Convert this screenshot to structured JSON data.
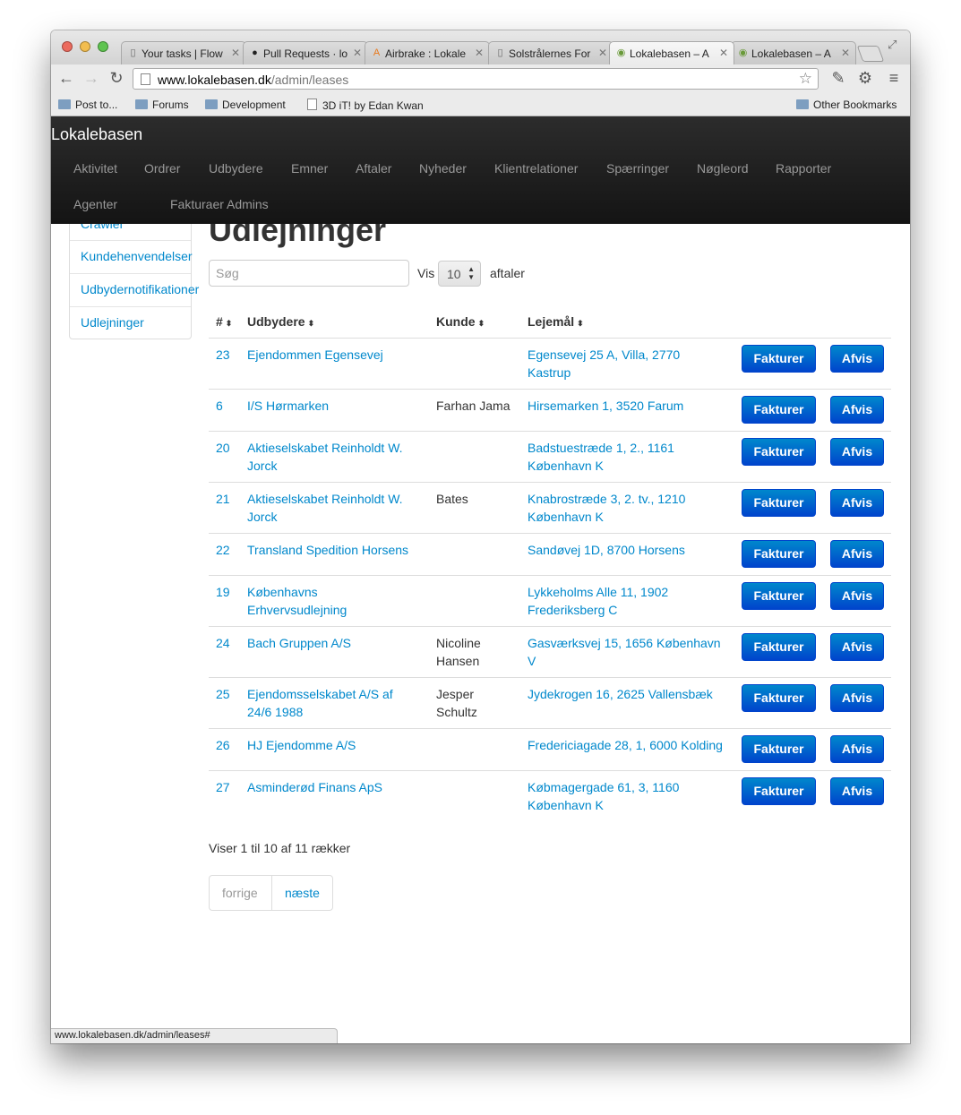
{
  "browser": {
    "tabs": [
      {
        "title": "Your tasks | Flow",
        "icon": "page-icon"
      },
      {
        "title": "Pull Requests · lo",
        "icon": "github-icon"
      },
      {
        "title": "Airbrake : Lokale",
        "icon": "airbrake-icon"
      },
      {
        "title": "Solstrålernes For",
        "icon": "page-icon"
      },
      {
        "title": "Lokalebasen – A",
        "icon": "map-pin-icon"
      },
      {
        "title": "Lokalebasen – A",
        "icon": "map-pin-icon"
      }
    ],
    "url_host": "www.lokalebasen.dk",
    "url_path": "/admin/leases",
    "bookmarks": [
      "Post to...",
      "Forums",
      "Development",
      "3D iT! by Edan Kwan"
    ],
    "other_bookmarks": "Other Bookmarks",
    "status_url": "www.lokalebasen.dk/admin/leases#"
  },
  "site": {
    "brand": "Lokalebasen",
    "nav": [
      "Aktivitet",
      "Ordrer",
      "Udbydere",
      "Emner",
      "Aftaler",
      "Nyheder",
      "Klientrelationer",
      "Spærringer",
      "Nøgleord",
      "Rapporter",
      "Agenter",
      "Fakturaer",
      "Admins"
    ]
  },
  "sidebar": {
    "items": [
      "Crawler",
      "Kundehenvendelser",
      "Udbydernotifikationer",
      "Udlejninger"
    ]
  },
  "main": {
    "title": "Udlejninger",
    "search_placeholder": "Søg",
    "show_label": "Vis",
    "page_size": "10",
    "after_label": "aftaler",
    "columns": [
      "#",
      "Udbydere",
      "Kunde",
      "Lejemål"
    ],
    "invoice_label": "Fakturer",
    "reject_label": "Afvis",
    "rows": [
      {
        "id": "23",
        "provider": [
          "Ejendommen Egensevej"
        ],
        "customer": [],
        "lease": [
          "Egensevej 25 A, Villa, 2770",
          "Kastrup"
        ]
      },
      {
        "id": "6",
        "provider": [
          "I/S Hørmarken"
        ],
        "customer": [
          "Farhan Jama"
        ],
        "lease": [
          "Hirsemarken 1, 3520 Farum"
        ]
      },
      {
        "id": "20",
        "provider": [
          "Aktieselskabet Reinholdt W.",
          "Jorck"
        ],
        "customer": [],
        "lease": [
          "Badstuestræde 1, 2., 1161",
          "København K"
        ]
      },
      {
        "id": "21",
        "provider": [
          "Aktieselskabet Reinholdt W.",
          "Jorck"
        ],
        "customer": [
          "Bates"
        ],
        "lease": [
          "Knabrostræde 3, 2. tv., 1210",
          "København K"
        ]
      },
      {
        "id": "22",
        "provider": [
          "Transland Spedition Horsens"
        ],
        "customer": [],
        "lease": [
          "Sandøvej 1D, 8700 Horsens"
        ]
      },
      {
        "id": "19",
        "provider": [
          "Københavns",
          "Erhvervsudlejning"
        ],
        "customer": [],
        "lease": [
          "Lykkeholms Alle 11, 1902",
          "Frederiksberg C"
        ]
      },
      {
        "id": "24",
        "provider": [
          "Bach Gruppen A/S"
        ],
        "customer": [
          "Nicoline",
          "Hansen"
        ],
        "lease": [
          "Gasværksvej 15, 1656 København",
          "V"
        ]
      },
      {
        "id": "25",
        "provider": [
          "Ejendomsselskabet A/S af",
          "24/6 1988"
        ],
        "customer": [
          "Jesper",
          "Schultz"
        ],
        "lease": [
          "Jydekrogen 16, 2625 Vallensbæk"
        ]
      },
      {
        "id": "26",
        "provider": [
          "HJ Ejendomme A/S"
        ],
        "customer": [],
        "lease": [
          "Fredericiagade 28, 1, 6000 Kolding"
        ]
      },
      {
        "id": "27",
        "provider": [
          "Asminderød Finans ApS"
        ],
        "customer": [],
        "lease": [
          "Købmagergade 61, 3, 1160",
          "København K"
        ]
      }
    ],
    "summary": "Viser 1 til 10 af 11 rækker",
    "prev_label": "forrige",
    "next_label": "næste"
  }
}
